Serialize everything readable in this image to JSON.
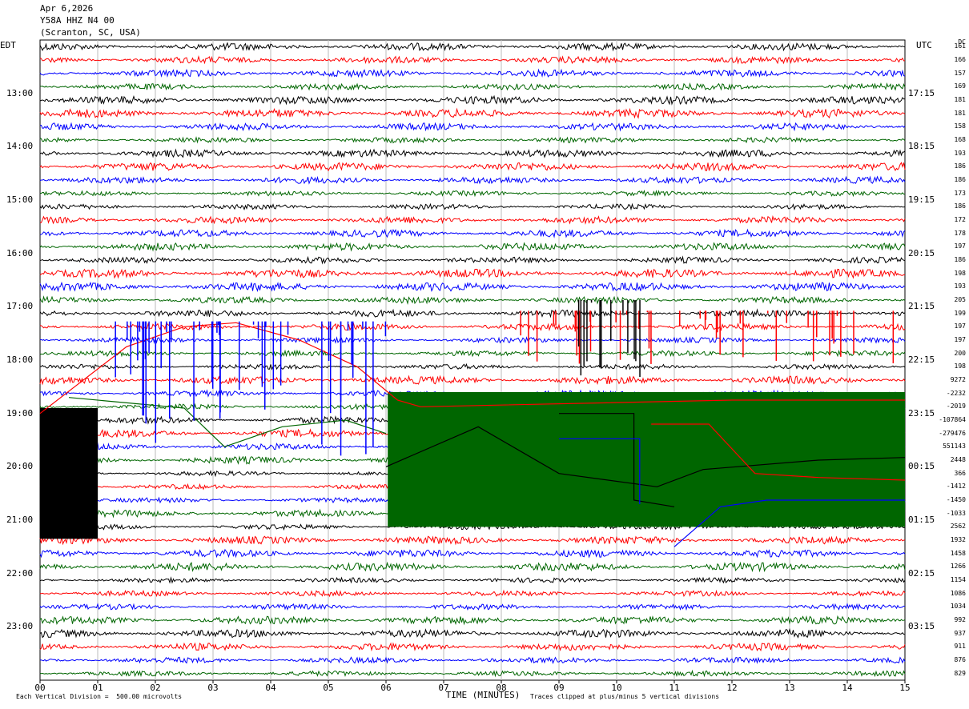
{
  "header": {
    "date": "Apr 6,2026",
    "station": "Y58A HHZ N4 00",
    "location": "(Scranton, SC, USA)"
  },
  "left_tz": "EDT",
  "right_tz": "UTC",
  "dc_header": "DC",
  "colors": [
    "#000000",
    "#ff0000",
    "#0000ff",
    "#006600"
  ],
  "chart_data": {
    "type": "line",
    "title": "Y58A HHZ N4 00",
    "xlabel": "TIME (MINUTES)",
    "xlim": [
      0,
      15
    ],
    "x_ticks": [
      "00",
      "01",
      "02",
      "03",
      "04",
      "05",
      "06",
      "07",
      "08",
      "09",
      "10",
      "11",
      "12",
      "13",
      "14",
      "15"
    ],
    "left_time_labels": [
      "13:00",
      "14:00",
      "15:00",
      "16:00",
      "17:00",
      "18:00",
      "19:00",
      "20:00",
      "21:00",
      "22:00",
      "23:00"
    ],
    "right_time_labels": [
      "17:15",
      "18:15",
      "19:15",
      "20:15",
      "21:15",
      "22:15",
      "23:15",
      "00:15",
      "01:15",
      "02:15",
      "03:15"
    ],
    "dc_offsets": [
      "161",
      "166",
      "157",
      "169",
      "181",
      "181",
      "158",
      "168",
      "193",
      "186",
      "186",
      "173",
      "186",
      "172",
      "178",
      "197",
      "186",
      "198",
      "193",
      "205",
      "199",
      "197",
      "197",
      "200",
      "198",
      "9272",
      "-2232",
      "-2019",
      "-107864",
      "-279476",
      "551143",
      "2448",
      "366",
      "-1412",
      "-1450",
      "-1033",
      "2562",
      "1932",
      "1458",
      "1266",
      "1154",
      "1086",
      "1034",
      "992",
      "937",
      "911",
      "876",
      "829"
    ],
    "footer_scale": "Each Vertical Division =  500.00 microvolts",
    "footer_clip": "Traces clipped at plus/minus 5 vertical divisions"
  }
}
